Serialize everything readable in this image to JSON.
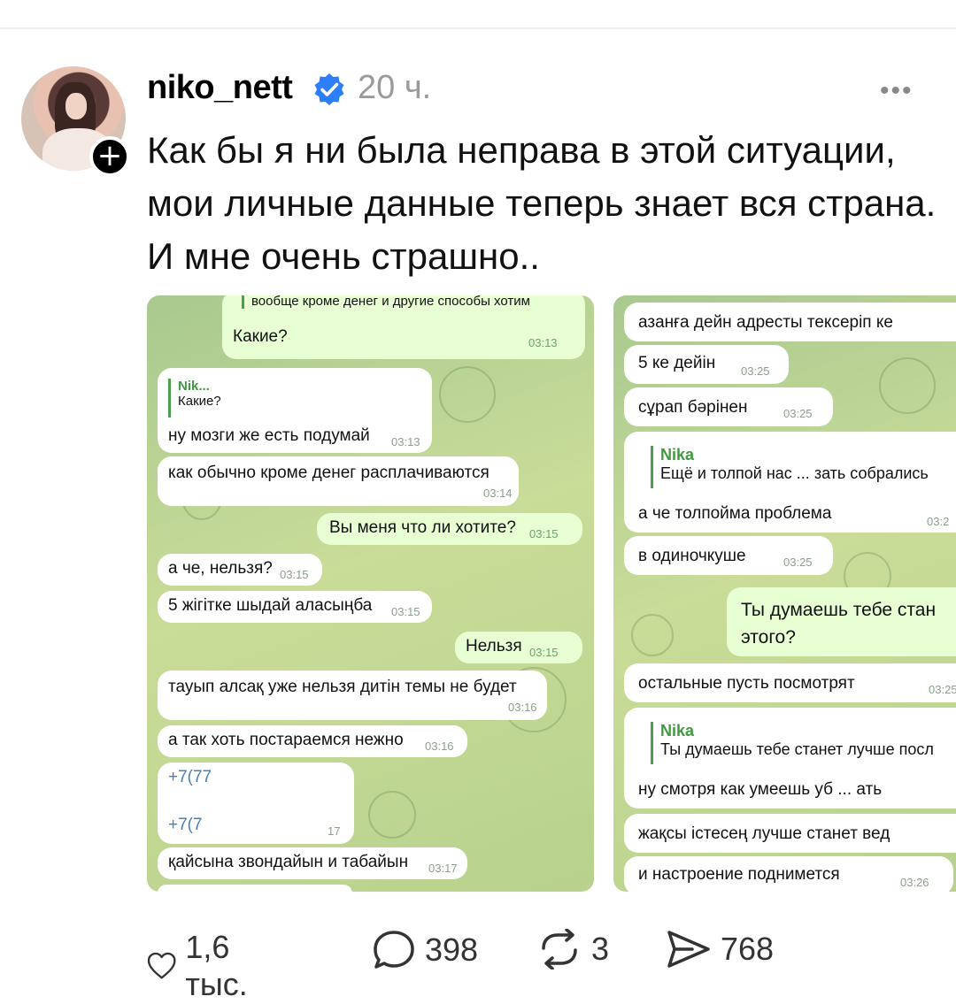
{
  "post": {
    "username": "niko_nett",
    "time": "20 ч.",
    "more": "•••",
    "text": "Как бы я ни была неправа в этой ситуации, мои личные данные теперь знает вся страна. И мне очень страшно..",
    "follow_plus": "+"
  },
  "shot1": {
    "top_quote": "вообще кроме денег и другие способы хотим",
    "m1": {
      "text": "Какие?",
      "time": "03:13"
    },
    "reply_name": "Nik...",
    "reply_quote": "Какие?",
    "m2": {
      "text": "ну мозги же есть подумай",
      "time": "03:13"
    },
    "m3": {
      "text": "как обычно кроме денег расплачиваются",
      "time": "03:14"
    },
    "m4": {
      "text": "Вы меня что ли хотите?",
      "time": "03:15"
    },
    "m5": {
      "text": "а че, нельзя?",
      "time": "03:15"
    },
    "m6": {
      "text": "5 жігітке шыдай аласыңба",
      "time": "03:15"
    },
    "m7": {
      "text": "Нельзя",
      "time": "03:15"
    },
    "m8": {
      "text": "тауып алсақ уже нельзя дитін темы не будет",
      "time": "03:16"
    },
    "m9": {
      "text": "а так хоть постараемся нежно",
      "time": "03:16"
    },
    "phone1": "+7(77",
    "phone2": "+7(7",
    "phone_time": "17",
    "m10": {
      "text": "қайсына звондайын и табайын",
      "time": "03:17"
    }
  },
  "shot2": {
    "m1": {
      "text": "азанға дейн адресты тексеріп ке"
    },
    "m2": {
      "text": "5 ке дейін",
      "time": "03:25"
    },
    "m3": {
      "text": "сұрап бәрінен",
      "time": "03:25"
    },
    "reply1_name": "Nika",
    "reply1_quote": "Ещё и толпой нас ... зать собрались",
    "m4": {
      "text": "а че толпойма проблема",
      "time": "03:2"
    },
    "m5": {
      "text": "в одиночкуше",
      "time": "03:25"
    },
    "m6": {
      "text": "Ты думаешь тебе стан этого?"
    },
    "m7": {
      "text": "остальные пусть посмотрят",
      "time": "03:25"
    },
    "reply2_name": "Nika",
    "reply2_quote": "Ты думаешь тебе станет лучше посл",
    "m8": {
      "text": "ну смотря как умеешь уб ... ать"
    },
    "m9": {
      "text": "жақсы істесең лучше станет вед"
    },
    "m10": {
      "text": "и настроение поднимется",
      "time": "03:26"
    }
  },
  "actions": {
    "likes": "1,6 тыс.",
    "comments": "398",
    "reposts": "3",
    "shares": "768"
  },
  "colors": {
    "verified": "#2d7ff9",
    "chat_in": "#ffffff",
    "chat_out": "#e7ffd3",
    "chat_bg": "#b7d28d",
    "time_gray": "#9a9a9a"
  }
}
